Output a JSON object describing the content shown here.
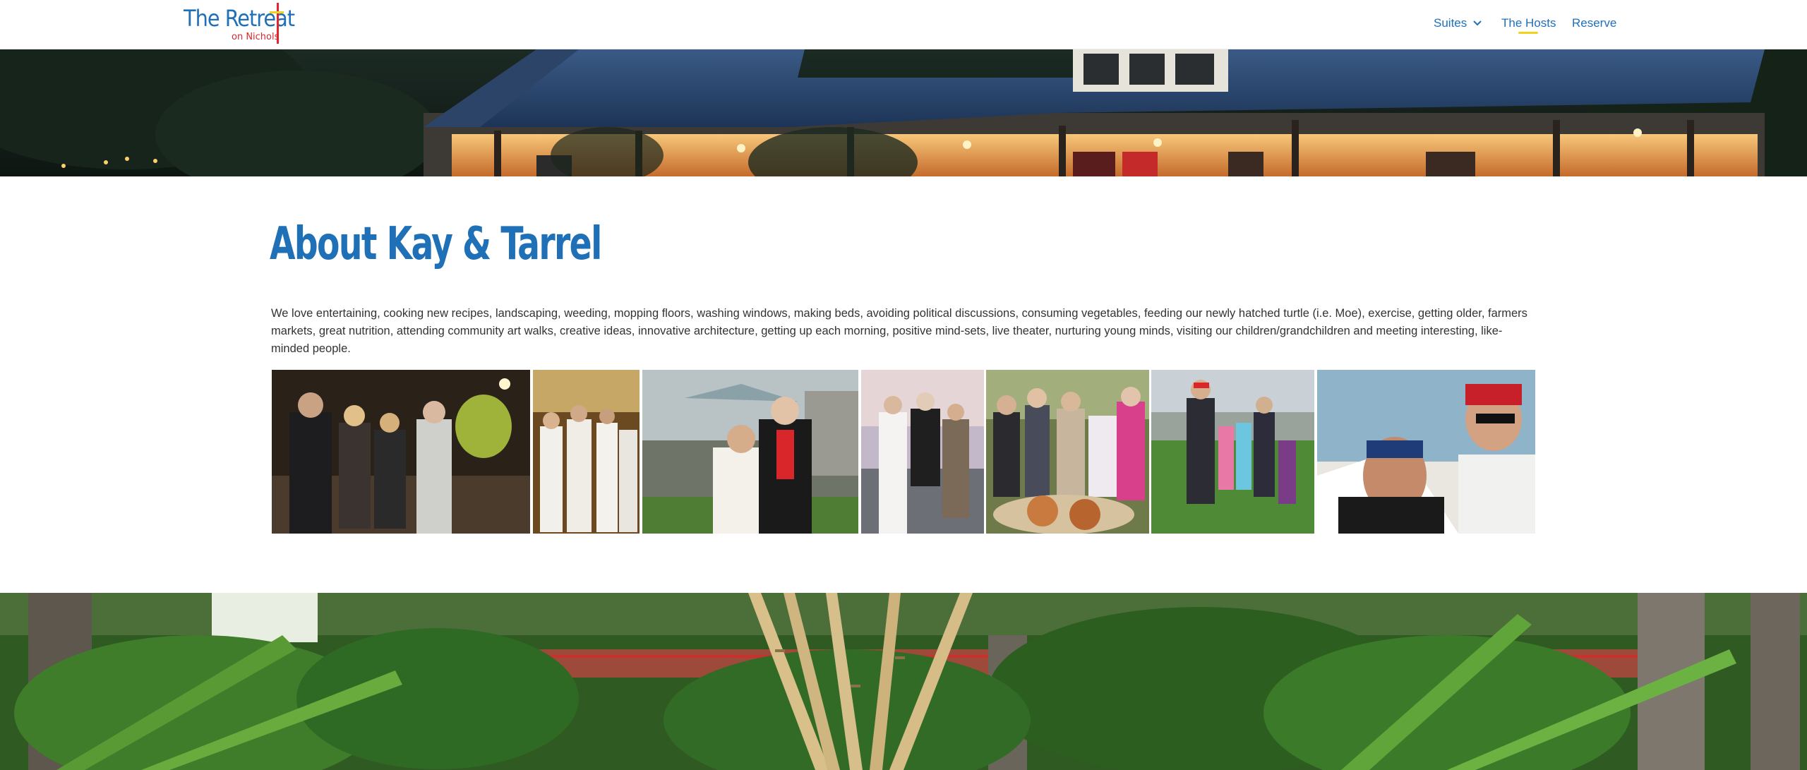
{
  "header": {
    "logo": {
      "main": "The Retreat",
      "sub": "on Nichols"
    },
    "nav": {
      "suites": "Suites",
      "hosts": "The Hosts",
      "reserve": "Reserve"
    }
  },
  "main": {
    "title": "About Kay & Tarrel",
    "body": "We love entertaining, cooking new recipes, landscaping, weeding, mopping floors, washing windows, making beds, avoiding political discussions, consuming vegetables, feeding our newly hatched turtle (i.e. Moe), exercise, getting older, farmers markets, great nutrition, attending community art walks, creative ideas, innovative architecture, getting up each morning, positive mind-sets, live theater, nurturing young minds, visiting our children/grandchildren and meeting interesting, like-minded people."
  },
  "colors": {
    "brand_blue": "#1f70b7",
    "brand_red": "#e1262d",
    "brand_yellow": "#f2d21b",
    "text": "#333333"
  },
  "icons": {
    "suites_dropdown": "chevron-down-icon"
  }
}
